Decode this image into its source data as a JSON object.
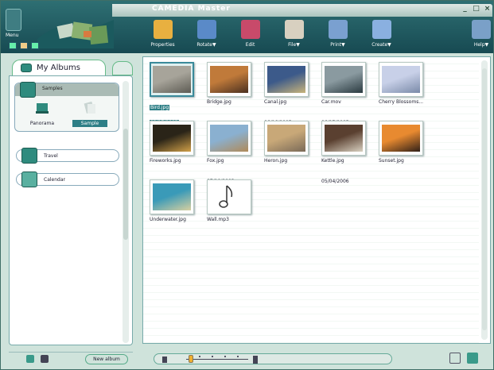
{
  "app": {
    "title": "CAMEDIA Master",
    "menu_label": "Menu",
    "window_buttons": [
      "_",
      "□",
      "×"
    ]
  },
  "toolbar": {
    "buttons": [
      {
        "label": "Properties",
        "icon": "properties-icon",
        "color": "#e8b040"
      },
      {
        "label": "Rotate▼",
        "icon": "rotate-icon",
        "color": "#5a8ac8"
      },
      {
        "label": "Edit",
        "icon": "edit-icon",
        "color": "#c84a6a"
      },
      {
        "label": "File▼",
        "icon": "file-icon",
        "color": "#d8d0c0"
      },
      {
        "label": "Print▼",
        "icon": "print-icon",
        "color": "#7aa0d0"
      },
      {
        "label": "Create▼",
        "icon": "create-icon",
        "color": "#8ab0e0"
      }
    ],
    "help_label": "Help▼"
  },
  "sidebar": {
    "tab_label": "My Albums",
    "albums": [
      {
        "name": "Samples",
        "expanded": true,
        "items": [
          {
            "label": "Panorama",
            "selected": false,
            "icon": "panorama-icon"
          },
          {
            "label": "Sample",
            "selected": true,
            "icon": "sample-icon"
          }
        ]
      },
      {
        "name": "Travel",
        "expanded": false
      },
      {
        "name": "Calendar",
        "expanded": false
      }
    ],
    "new_album_label": "New album"
  },
  "files": [
    {
      "name": "Bird.jpg",
      "date": "02/17/2003",
      "selected": true,
      "colors": [
        "#a7a49a",
        "#5d5b53"
      ]
    },
    {
      "name": "Bridge.jpg",
      "date": "",
      "selected": false,
      "colors": [
        "#c07a3a",
        "#4a3020"
      ]
    },
    {
      "name": "Canal.jpg",
      "date": "06/16/2005",
      "selected": false,
      "colors": [
        "#3c5a8a",
        "#c8b47a"
      ]
    },
    {
      "name": "Car.mov",
      "date": "06/27/2005",
      "selected": false,
      "colors": [
        "#8a9aa0",
        "#2a3a40"
      ]
    },
    {
      "name": "Cherry Blossoms...",
      "date": "",
      "selected": false,
      "colors": [
        "#c8d0e8",
        "#7a8aa8"
      ]
    },
    {
      "name": "Fireworks.jpg",
      "date": "",
      "selected": false,
      "colors": [
        "#2a2418",
        "#d0a048"
      ]
    },
    {
      "name": "Fox.jpg",
      "date": "07/10/2003",
      "selected": false,
      "colors": [
        "#8ab0d0",
        "#b08a58"
      ]
    },
    {
      "name": "Heron.jpg",
      "date": "",
      "selected": false,
      "colors": [
        "#c8a878",
        "#7a6a58"
      ]
    },
    {
      "name": "Kettle.jpg",
      "date": "05/04/2006",
      "selected": false,
      "colors": [
        "#5a4030",
        "#d8d0c0"
      ]
    },
    {
      "name": "Sunset.jpg",
      "date": "",
      "selected": false,
      "colors": [
        "#e88a30",
        "#302018"
      ]
    },
    {
      "name": "Underwater.jpg",
      "date": "",
      "selected": false,
      "colors": [
        "#3a9ab8",
        "#d8d0a0"
      ]
    },
    {
      "name": "Wall.mp3",
      "date": "",
      "selected": false,
      "colors": []
    }
  ],
  "zoom": {
    "level": 0.08
  },
  "accent": "#2e7f86"
}
